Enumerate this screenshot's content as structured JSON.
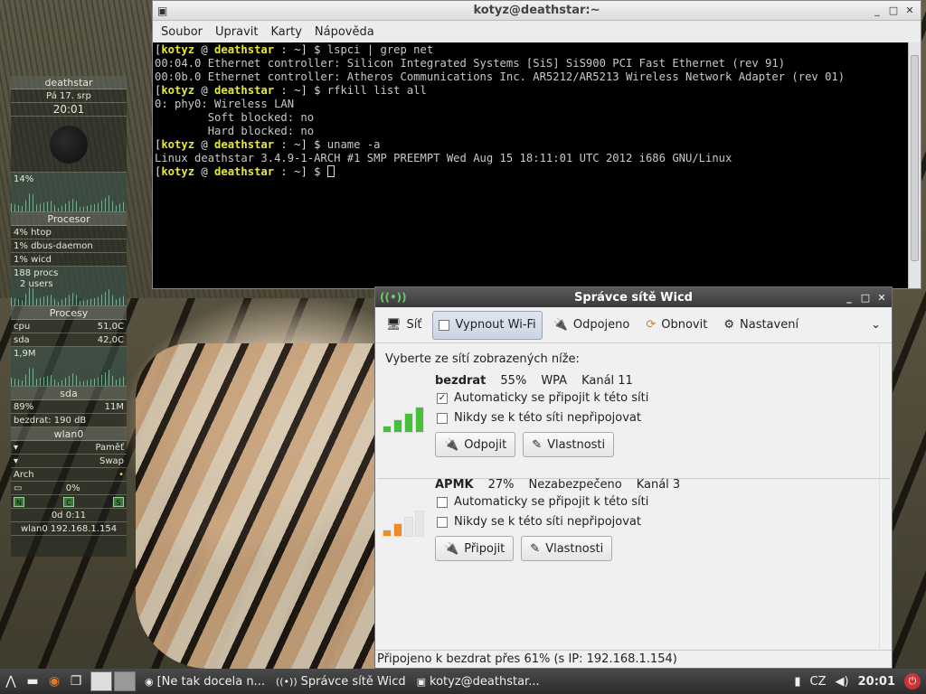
{
  "conky": {
    "hostname": "deathstar",
    "date": "Pá 17. srp",
    "time": "20:01",
    "cpu_percent": "14%",
    "section_cpu": "Procesor",
    "procs": [
      {
        "name": "htop",
        "pct": "4%"
      },
      {
        "name": "dbus-daemon",
        "pct": "1%"
      },
      {
        "name": "wicd",
        "pct": "1%"
      }
    ],
    "procs_count": "188 procs",
    "users": "2 users",
    "section_procs": "Procesy",
    "temps": [
      {
        "label": "cpu",
        "value": "51,0C"
      },
      {
        "label": "sda",
        "value": "42,0C"
      }
    ],
    "mem_value": "1,9M",
    "section_sda": "sda",
    "disk_pct": "89%",
    "disk_value": "11M",
    "wifi_signal": "bezdrat: 190 dB",
    "section_wlan": "wlan0",
    "section_mem": "Paměť",
    "section_swap": "Swap",
    "distro": "Arch",
    "battery": "0%",
    "ncs": [
      "N",
      "C",
      "S"
    ],
    "uptime": "0d  0:11",
    "ip": "wlan0 192.168.1.154"
  },
  "terminal": {
    "title": "kotyz@deathstar:~",
    "menu": [
      "Soubor",
      "Upravit",
      "Karty",
      "Nápověda"
    ],
    "user": "kotyz",
    "host": "deathstar",
    "lines": [
      {
        "type": "prompt",
        "cmd": "lspci | grep net"
      },
      {
        "type": "out",
        "text": "00:04.0 Ethernet controller: Silicon Integrated Systems [SiS] SiS900 PCI Fast Ethernet (rev 91)"
      },
      {
        "type": "out",
        "text": "00:0b.0 Ethernet controller: Atheros Communications Inc. AR5212/AR5213 Wireless Network Adapter (rev 01)"
      },
      {
        "type": "prompt",
        "cmd": "rfkill list all"
      },
      {
        "type": "out",
        "text": "0: phy0: Wireless LAN"
      },
      {
        "type": "out",
        "text": "        Soft blocked: no"
      },
      {
        "type": "out",
        "text": "        Hard blocked: no"
      },
      {
        "type": "prompt",
        "cmd": "uname -a"
      },
      {
        "type": "out",
        "text": "Linux deathstar 3.4.9-1-ARCH #1 SMP PREEMPT Wed Aug 15 18:11:01 UTC 2012 i686 GNU/Linux"
      },
      {
        "type": "prompt",
        "cmd": "",
        "cursor": true
      }
    ]
  },
  "wicd": {
    "title": "Správce sítě Wicd",
    "toolbar": {
      "network": "Síť",
      "disable_wifi": "Vypnout Wi-Fi",
      "disconnected": "Odpojeno",
      "refresh": "Obnovit",
      "settings": "Nastavení"
    },
    "instruction": "Vyberte ze sítí zobrazených níže:",
    "networks": [
      {
        "name": "bezdrat",
        "signal": "55%",
        "security": "WPA",
        "channel": "Kanál 11",
        "auto_connect_label": "Automaticky se připojit k této síti",
        "auto_connect": true,
        "never_label": "Nikdy se k této síti nepřipojovat",
        "never": false,
        "action_label": "Odpojit",
        "properties_label": "Vlastnosti",
        "signal_color": "#46c03a",
        "bars_filled": 4
      },
      {
        "name": "APMK",
        "signal": "27%",
        "security": "Nezabezpečeno",
        "channel": "Kanál 3",
        "auto_connect_label": "Automaticky se připojit k této síti",
        "auto_connect": false,
        "never_label": "Nikdy se k této síti nepřipojovat",
        "never": false,
        "action_label": "Připojit",
        "properties_label": "Vlastnosti",
        "signal_color": "#f08a2a",
        "bars_filled": 2
      }
    ],
    "status": "Připojeno k bezdrat přes 61% (s IP: 192.168.1.154)"
  },
  "taskbar": {
    "tasks": [
      {
        "label": "[Ne tak docela n...",
        "icon": "firefox-icon"
      },
      {
        "label": "Správce sítě Wicd",
        "icon": "wicd-icon"
      },
      {
        "label": "kotyz@deathstar...",
        "icon": "terminal-icon"
      }
    ],
    "keyboard_layout": "CZ",
    "clock": "20:01"
  }
}
